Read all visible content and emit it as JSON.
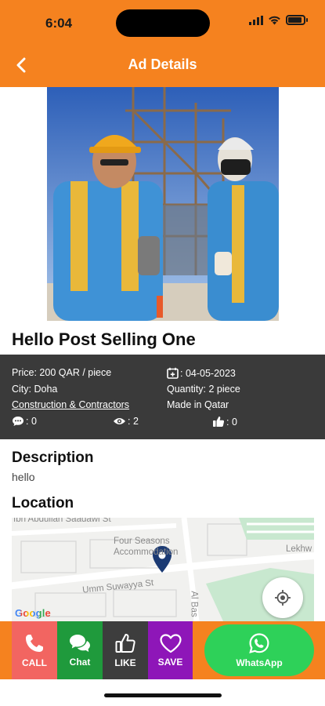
{
  "status": {
    "time": "6:04"
  },
  "header": {
    "title": "Ad Details",
    "back_icon": "chevron-left-icon"
  },
  "ad": {
    "title": "Hello Post Selling One",
    "price": "Price: 200 QAR / piece",
    "date": ": 04-05-2023",
    "city": "City: Doha",
    "quantity": "Quantity: 2 piece",
    "category": "Construction & Contractors",
    "origin": "Made in Qatar",
    "comments": ": 0",
    "views": ": 2",
    "likes": ": 0"
  },
  "description": {
    "heading": "Description",
    "text": "hello"
  },
  "location": {
    "heading": "Location",
    "map_labels": {
      "top_street": "Ibn Abdullah Saadawi St",
      "place_line1": "Four Seasons",
      "place_line2": "Accommodation",
      "street": "Umm Suwayya St",
      "side": "Lekhw",
      "vertical_street": "Al Bas"
    },
    "google": "Google"
  },
  "actions": {
    "call": "CALL",
    "chat": "Chat",
    "like": "LIKE",
    "save": "SAVE",
    "whatsapp": "WhatsApp"
  },
  "colors": {
    "accent": "#f5821f",
    "call": "#f26561",
    "chat": "#1f9a3c",
    "like": "#3d3d3d",
    "save": "#8e16b8",
    "whatsapp": "#2ed159",
    "pin": "#1b3a73"
  }
}
